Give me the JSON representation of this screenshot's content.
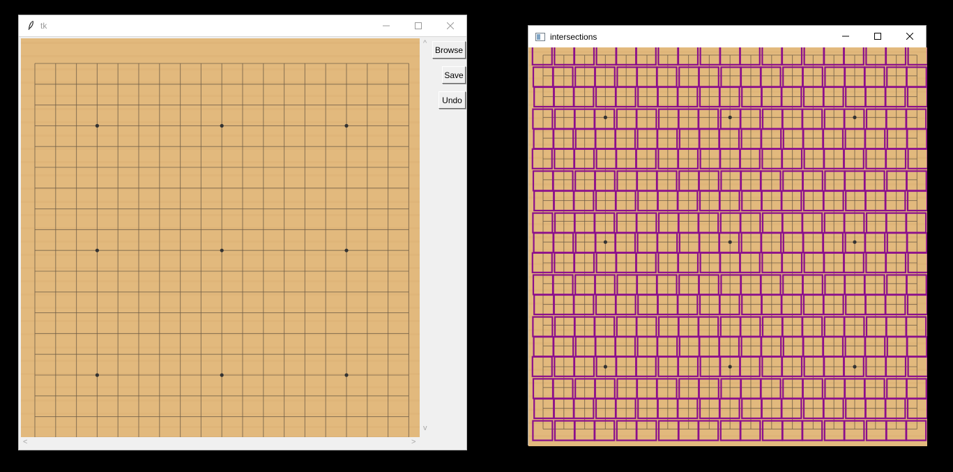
{
  "tk_window": {
    "title": "tk",
    "buttons": {
      "browse": "Browse",
      "save": "Save",
      "undo": "Undo"
    },
    "board": {
      "lines": 19,
      "star_points": 9
    }
  },
  "intersections_window": {
    "title": "intersections",
    "box_color": "#8b0e8c",
    "grid": {
      "rows": 19,
      "cols": 19
    }
  },
  "colors": {
    "wood": "#e2b97d",
    "grid_line": "#6b5a45",
    "desktop": "#000000"
  }
}
